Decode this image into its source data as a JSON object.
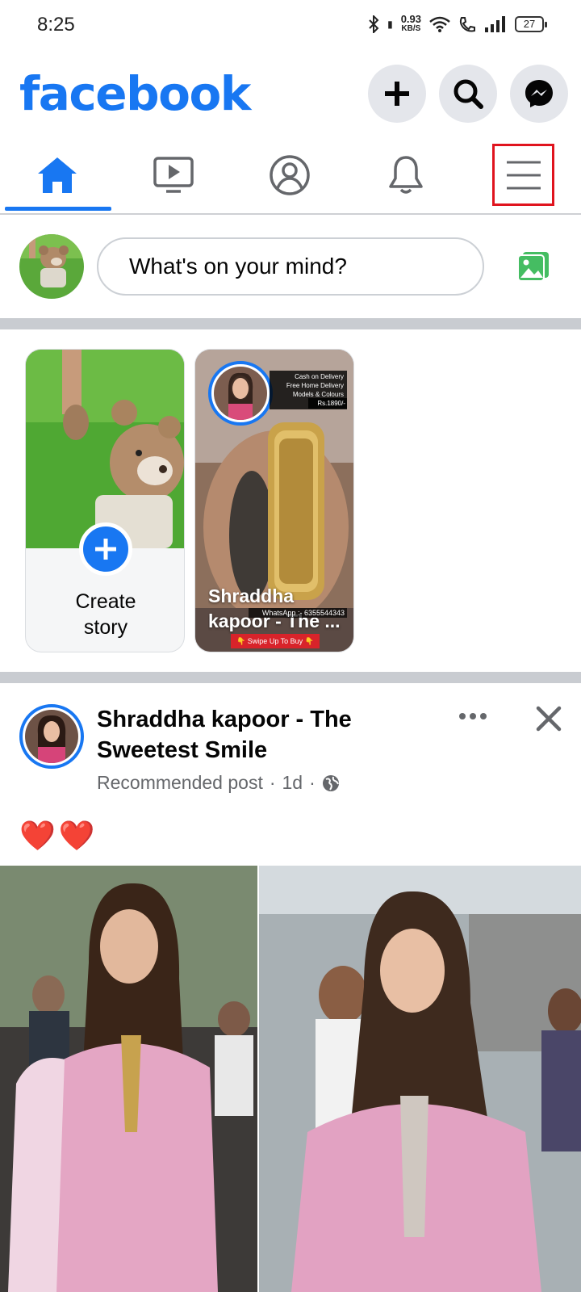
{
  "status_bar": {
    "time": "8:25",
    "net_speed_value": "0.93",
    "net_speed_unit": "KB/S",
    "battery": "27"
  },
  "header": {
    "logo": "facebook",
    "brand_color": "#1877f2"
  },
  "tabs": [
    {
      "name": "home",
      "icon": "home-icon",
      "active": true
    },
    {
      "name": "watch",
      "icon": "video-icon",
      "active": false
    },
    {
      "name": "profile",
      "icon": "profile-icon",
      "active": false
    },
    {
      "name": "notifications",
      "icon": "bell-icon",
      "active": false
    },
    {
      "name": "menu",
      "icon": "hamburger-menu-icon",
      "active": false,
      "highlighted": true
    }
  ],
  "composer": {
    "placeholder": "What's on your mind?"
  },
  "stories": {
    "create_label_line1": "Create",
    "create_label_line2": "story",
    "story2": {
      "name_line1": "Shraddha",
      "name_line2": "kapoor - The ...",
      "ad_line1": "Cash on Delivery",
      "ad_line2": "Free Home Delivery",
      "ad_line3": "Models & Colours Available",
      "price": "Rs.1890/-",
      "whatsapp": "WhatsApp :- 6355544343",
      "swipe": "👇 Swipe Up To Buy 👇"
    }
  },
  "post": {
    "title": "Shraddha kapoor - The Sweetest Smile",
    "meta_label": "Recommended post",
    "meta_sep1": "·",
    "meta_time": "1d",
    "meta_sep2": "·",
    "text": "❤️❤️"
  }
}
